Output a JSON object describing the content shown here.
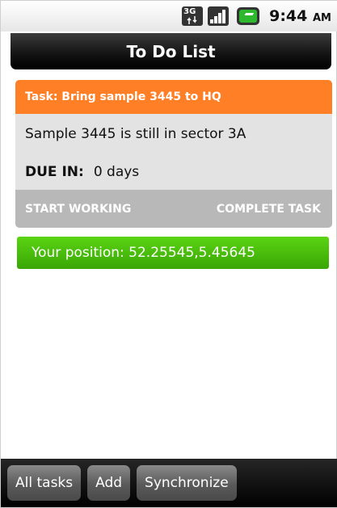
{
  "status_bar": {
    "network": "3G",
    "time": "9:44",
    "ampm": "AM",
    "icons": [
      "3g-data-icon",
      "signal-strength-icon",
      "battery-icon"
    ]
  },
  "header": {
    "title": "To Do List"
  },
  "task": {
    "title": "Task: Bring sample 3445 to HQ",
    "description": "Sample 3445 is still in sector 3A",
    "due_label": "DUE IN:",
    "due_value": "0 days",
    "start_label": "START WORKING",
    "complete_label": "COMPLETE TASK"
  },
  "position": {
    "text": "Your position: 52.25545,5.45645"
  },
  "toolbar": {
    "all_tasks_label": "All tasks",
    "add_label": "Add",
    "sync_label": "Synchronize"
  },
  "colors": {
    "task_header": "#ff7f27",
    "position_bar": "#44b20a",
    "card_background": "#e3e3e3",
    "card_actions": "#b8b8b8",
    "toolbar": "#1a1a1a"
  }
}
